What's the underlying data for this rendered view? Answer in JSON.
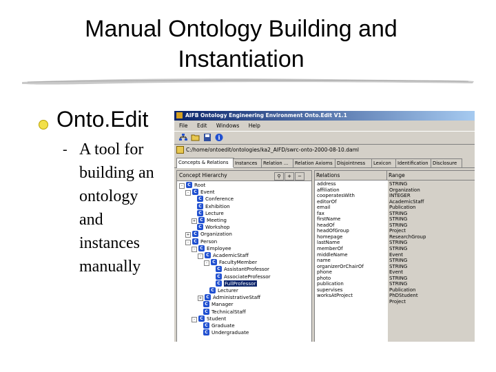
{
  "slide": {
    "title_line1": "Manual Ontology Building and",
    "title_line2": "Instantiation",
    "bullet": "Onto.Edit",
    "sub_dash": "-",
    "sub_lines": [
      "A tool for",
      "building an",
      "ontology",
      "and",
      "instances",
      "manually"
    ]
  },
  "colors": {
    "accent": "#f2e04a",
    "titlebar": "#0a246a",
    "class_icon": "#2050d0"
  },
  "app": {
    "window_title": "AIFB Ontology Engineering Environment Onto.Edit V1.1",
    "menu": [
      "File",
      "Edit",
      "Windows",
      "Help"
    ],
    "path": "C:/home/ontoedit/ontologies/ka2_AIFD/swrc-onto-2000-08-10.daml",
    "tabs": [
      "Concepts & Relations",
      "Instances",
      "Relation ...",
      "Relation Axioms",
      "Disjointness",
      "Lexicon",
      "Identification",
      "Disclosure"
    ],
    "concept_header": "Concept Hierarchy",
    "tree": [
      {
        "label": "Root",
        "level": 0,
        "pm": "-"
      },
      {
        "label": "Event",
        "level": 1,
        "pm": "-"
      },
      {
        "label": "Conference",
        "level": 2,
        "pm": ""
      },
      {
        "label": "Exhibition",
        "level": 2,
        "pm": ""
      },
      {
        "label": "Lecture",
        "level": 2,
        "pm": ""
      },
      {
        "label": "Meeting",
        "level": 2,
        "pm": "+"
      },
      {
        "label": "Workshop",
        "level": 2,
        "pm": ""
      },
      {
        "label": "Organization",
        "level": 1,
        "pm": "+"
      },
      {
        "label": "Person",
        "level": 1,
        "pm": "-"
      },
      {
        "label": "Employee",
        "level": 2,
        "pm": "-"
      },
      {
        "label": "AcademicStaff",
        "level": 3,
        "pm": "-"
      },
      {
        "label": "FacultyMember",
        "level": 4,
        "pm": "-"
      },
      {
        "label": "AssistantProfessor",
        "level": 5,
        "pm": ""
      },
      {
        "label": "AssociateProfessor",
        "level": 5,
        "pm": ""
      },
      {
        "label": "FullProfessor",
        "level": 5,
        "pm": "",
        "selected": true
      },
      {
        "label": "Lecturer",
        "level": 4,
        "pm": ""
      },
      {
        "label": "AdministrativeStaff",
        "level": 3,
        "pm": "+"
      },
      {
        "label": "Manager",
        "level": 3,
        "pm": ""
      },
      {
        "label": "TechnicalStaff",
        "level": 3,
        "pm": ""
      },
      {
        "label": "Student",
        "level": 2,
        "pm": "-"
      },
      {
        "label": "Graduate",
        "level": 3,
        "pm": ""
      },
      {
        "label": "Undergraduate",
        "level": 3,
        "pm": ""
      }
    ],
    "table_headers": [
      "Relations",
      "Range"
    ],
    "relations": [
      "address",
      "affiliation",
      "cooperatesWith",
      "editorOf",
      "email",
      "fax",
      "firstName",
      "headOf",
      "headOfGroup",
      "homepage",
      "lastName",
      "memberOf",
      "middleName",
      "name",
      "organizerOrChairOf",
      "phone",
      "photo",
      "publication",
      "supervises",
      "worksAtProject"
    ],
    "ranges": [
      "STRING",
      "Organization",
      "INTEGER",
      "AcademicStaff",
      "Publication",
      "STRING",
      "STRING",
      "STRING",
      "Project",
      "ResearchGroup",
      "STRING",
      "STRING",
      "Event",
      "STRING",
      "STRING",
      "Event",
      "STRING",
      "STRING",
      "Publication",
      "PhDStudent",
      "Project"
    ]
  }
}
